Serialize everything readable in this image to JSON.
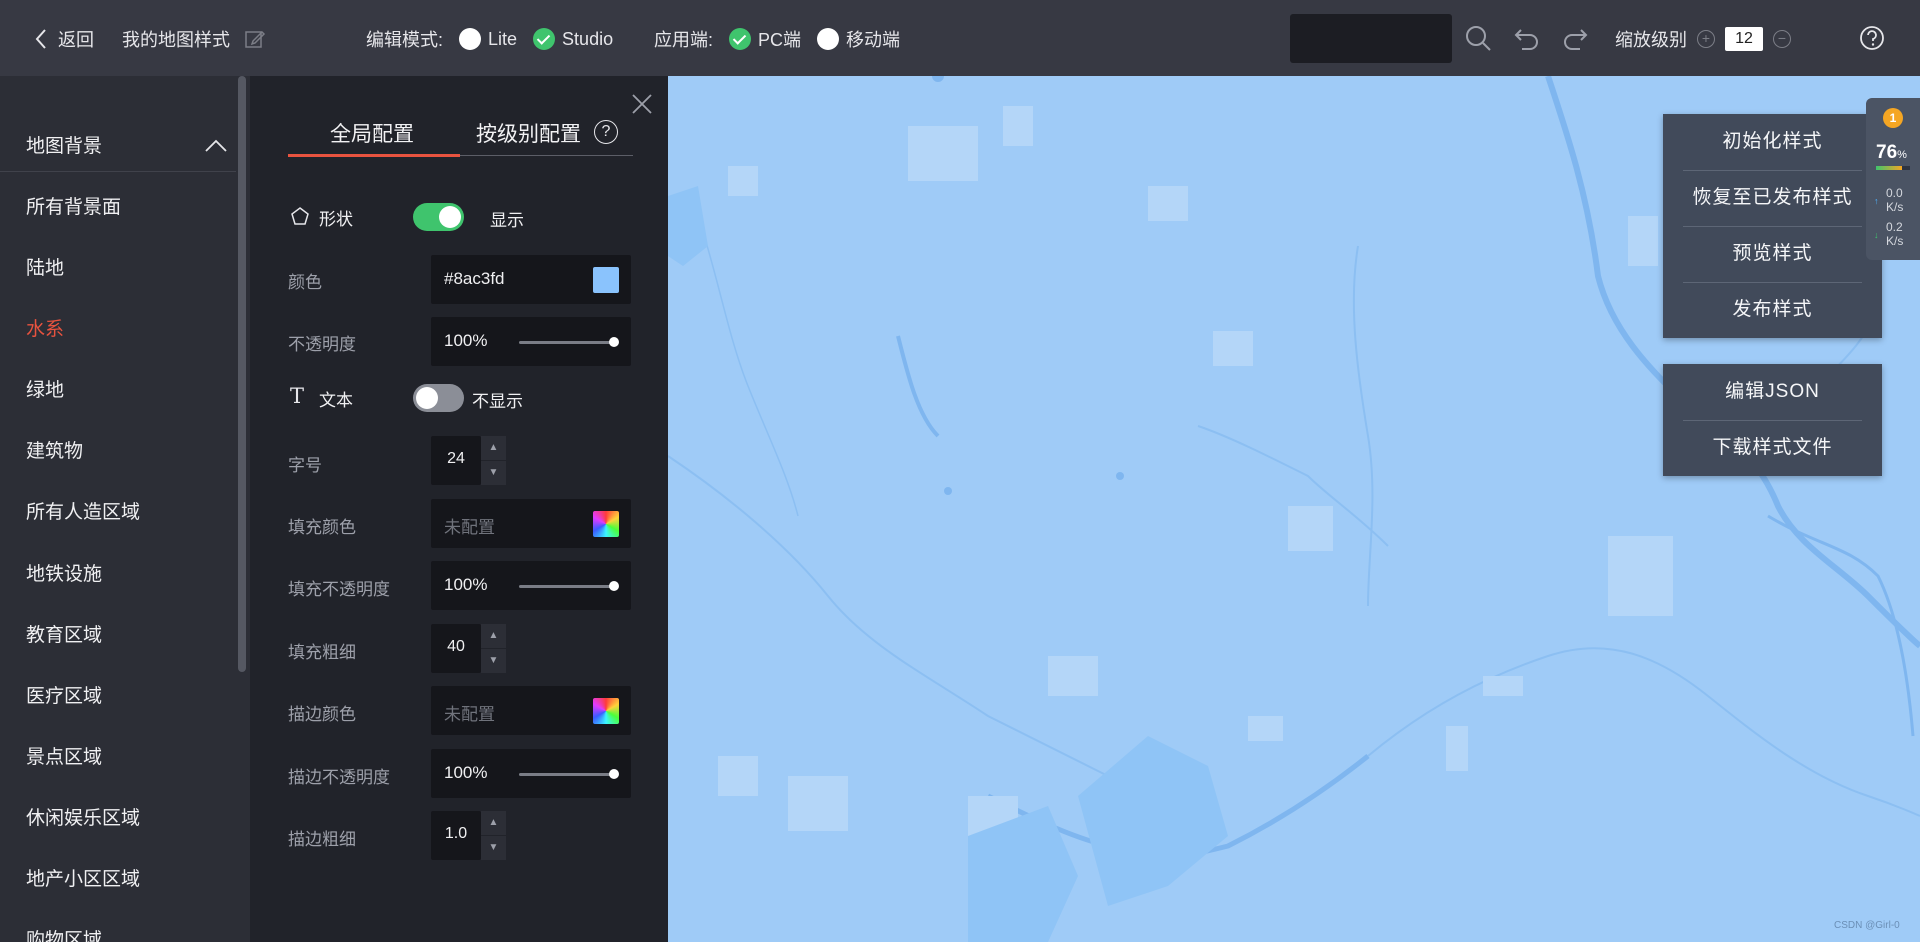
{
  "topbar": {
    "back_label": "返回",
    "map_title": "我的地图样式",
    "edit_mode_label": "编辑模式:",
    "edit_modes": [
      {
        "label": "Lite",
        "selected": false
      },
      {
        "label": "Studio",
        "selected": true
      }
    ],
    "platform_label": "应用端:",
    "platforms": [
      {
        "label": "PC端",
        "selected": true
      },
      {
        "label": "移动端",
        "selected": false
      }
    ],
    "zoom_label": "缩放级别",
    "zoom_value": "12",
    "icons": [
      "back-chevron-icon",
      "edit-icon",
      "search-icon",
      "undo-icon",
      "redo-icon",
      "zoom-in-icon",
      "zoom-out-icon",
      "help-icon"
    ]
  },
  "sidebar": {
    "group_label": "地图背景",
    "items": [
      {
        "label": "所有背景面",
        "active": false
      },
      {
        "label": "陆地",
        "active": false
      },
      {
        "label": "水系",
        "active": true
      },
      {
        "label": "绿地",
        "active": false
      },
      {
        "label": "建筑物",
        "active": false
      },
      {
        "label": "所有人造区域",
        "active": false
      },
      {
        "label": "地铁设施",
        "active": false
      },
      {
        "label": "教育区域",
        "active": false
      },
      {
        "label": "医疗区域",
        "active": false
      },
      {
        "label": "景点区域",
        "active": false
      },
      {
        "label": "休闲娱乐区域",
        "active": false
      },
      {
        "label": "地产小区区域",
        "active": false
      },
      {
        "label": "购物区域",
        "active": false
      }
    ]
  },
  "panel": {
    "tabs": [
      {
        "label": "全局配置",
        "active": true
      },
      {
        "label": "按级别配置",
        "active": false
      }
    ],
    "shape": {
      "label": "形状",
      "toggle_on": true,
      "toggle_label": "显示"
    },
    "color": {
      "label": "颜色",
      "value": "#8ac3fd"
    },
    "opacity": {
      "label": "不透明度",
      "value": "100%"
    },
    "text": {
      "label": "文本",
      "toggle_on": false,
      "toggle_label": "不显示"
    },
    "font_size": {
      "label": "字号",
      "value": "24"
    },
    "fill_color": {
      "label": "填充颜色",
      "value": "未配置"
    },
    "fill_opacity": {
      "label": "填充不透明度",
      "value": "100%"
    },
    "fill_weight": {
      "label": "填充粗细",
      "value": "40"
    },
    "stroke_color": {
      "label": "描边颜色",
      "value": "未配置"
    },
    "stroke_opacity": {
      "label": "描边不透明度",
      "value": "100%"
    },
    "stroke_weight": {
      "label": "描边粗细",
      "value": "1.0"
    }
  },
  "map": {
    "water_color": "#9fcbf7",
    "actions_top": [
      "初始化样式",
      "恢复至已发布样式",
      "预览样式",
      "发布样式"
    ],
    "actions_bottom": [
      "编辑JSON",
      "下载样式文件"
    ]
  },
  "net_monitor": {
    "badge": "1",
    "percent": "76",
    "percent_unit": "%",
    "up_speed": "0.0",
    "down_speed": "0.2",
    "unit": "K/s"
  },
  "watermark": "CSDN @Girl-0"
}
